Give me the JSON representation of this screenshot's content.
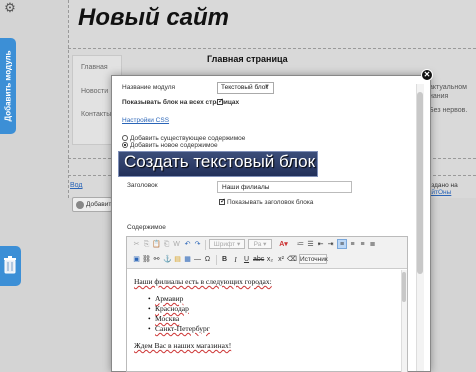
{
  "site": {
    "title": "Новый сайт",
    "nav_items": [
      "Главная",
      "Новости",
      "Контакты"
    ],
    "main_heading": "Главная страница",
    "side_text": [
      "актуальном",
      "нания",
      "Без нервов."
    ],
    "video_link": "Вод",
    "credit_prefix": "Создано на ",
    "credit_link": "СайтОны",
    "add_button": "Добавить"
  },
  "sidebar": {
    "add_module_label": "Добавить модуль",
    "gear_icon": "gear-icon",
    "trash_icon": "trash-icon"
  },
  "modal": {
    "module_name_label": "Название модуля",
    "module_name_value": "Текстовый блок",
    "show_all_pages_label": "Показывать блок на всех страницах",
    "css_settings_link": "Настройки CSS",
    "radio_existing": "Добавить существующее содержимое",
    "radio_new": "Добавить новое содержимое",
    "banner_title": "Создать текстовый блок",
    "heading_label": "Заголовок",
    "heading_value": "Наши филиалы",
    "show_heading_label": "Показывать заголовок блока",
    "content_label": "Содержимое",
    "close_icon": "close-icon"
  },
  "toolbar": {
    "font_label": "Шрифт",
    "source_label": "Источник"
  },
  "content": {
    "intro": "Наши филиалы есть в следующих городах:",
    "cities": [
      "Армавир",
      "Краснодар",
      "Москва",
      "Санкт-Петербург"
    ],
    "outro": "Ждем Вас в наших магазинах!"
  },
  "colors": {
    "accent": "#3c8fd6",
    "banner": "#2e3d68",
    "link": "#2a65b8"
  }
}
